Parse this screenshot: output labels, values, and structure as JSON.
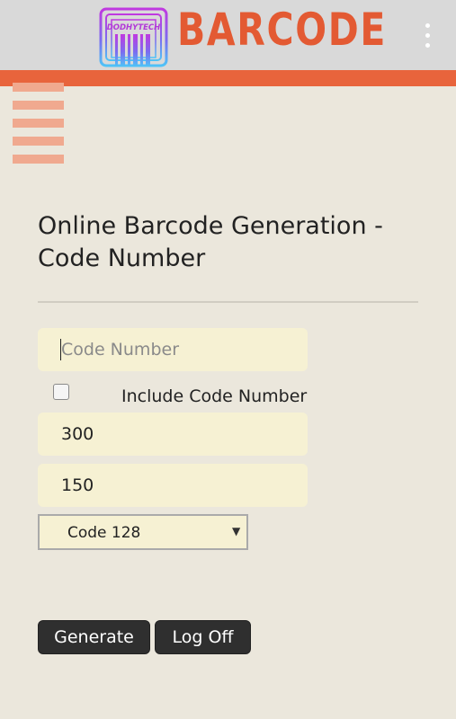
{
  "app": {
    "logo_small_text": "DODHYTECH",
    "logo_text": "BARCODE",
    "overflow_icon": "more-vert-icon",
    "menu_icon": "hamburger-menu-icon"
  },
  "colors": {
    "appbar": "#d9d9d9",
    "accent": "#e8643c",
    "background": "#ebe7dc",
    "field_bg": "#f6f1d3",
    "button_bg": "#2f2f2f"
  },
  "main": {
    "title": "Online Barcode Generation - Code Number",
    "code_input": {
      "value": "",
      "placeholder": "Code Number"
    },
    "include_checkbox": {
      "label": "Include Code Number",
      "checked": false
    },
    "width_input": {
      "value": "300"
    },
    "height_input": {
      "value": "150"
    },
    "type_select": {
      "selected": "Code 128"
    },
    "generate_label": "Generate",
    "logoff_label": "Log Off"
  }
}
